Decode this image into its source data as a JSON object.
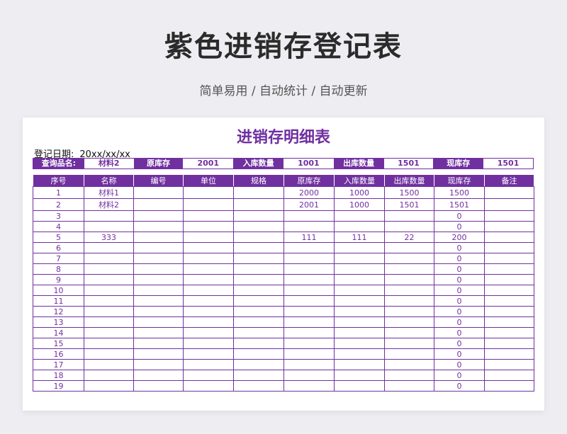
{
  "page": {
    "title": "紫色进销存登记表",
    "subtitle": "简单易用 / 自动统计 / 自动更新"
  },
  "sheet": {
    "title": "进销存明细表",
    "date_label": "登记日期:",
    "date_value": "20xx/xx/xx",
    "query": [
      {
        "label": "查询品名:",
        "value": "材料2"
      },
      {
        "label": "原库存",
        "value": "2001"
      },
      {
        "label": "入库数量",
        "value": "1001"
      },
      {
        "label": "出库数量",
        "value": "1501"
      },
      {
        "label": "现库存",
        "value": "1501"
      }
    ],
    "columns": [
      "序号",
      "名称",
      "编号",
      "单位",
      "规格",
      "原库存",
      "入库数量",
      "出库数量",
      "现库存",
      "备注"
    ],
    "rows": [
      [
        "1",
        "材料1",
        "",
        "",
        "",
        "2000",
        "1000",
        "1500",
        "1500",
        ""
      ],
      [
        "2",
        "材料2",
        "",
        "",
        "",
        "2001",
        "1000",
        "1501",
        "1501",
        ""
      ],
      [
        "3",
        "",
        "",
        "",
        "",
        "",
        "",
        "",
        "0",
        ""
      ],
      [
        "4",
        "",
        "",
        "",
        "",
        "",
        "",
        "",
        "0",
        ""
      ],
      [
        "5",
        "333",
        "",
        "",
        "",
        "111",
        "111",
        "22",
        "200",
        ""
      ],
      [
        "6",
        "",
        "",
        "",
        "",
        "",
        "",
        "",
        "0",
        ""
      ],
      [
        "7",
        "",
        "",
        "",
        "",
        "",
        "",
        "",
        "0",
        ""
      ],
      [
        "8",
        "",
        "",
        "",
        "",
        "",
        "",
        "",
        "0",
        ""
      ],
      [
        "9",
        "",
        "",
        "",
        "",
        "",
        "",
        "",
        "0",
        ""
      ],
      [
        "10",
        "",
        "",
        "",
        "",
        "",
        "",
        "",
        "0",
        ""
      ],
      [
        "11",
        "",
        "",
        "",
        "",
        "",
        "",
        "",
        "0",
        ""
      ],
      [
        "12",
        "",
        "",
        "",
        "",
        "",
        "",
        "",
        "0",
        ""
      ],
      [
        "13",
        "",
        "",
        "",
        "",
        "",
        "",
        "",
        "0",
        ""
      ],
      [
        "14",
        "",
        "",
        "",
        "",
        "",
        "",
        "",
        "0",
        ""
      ],
      [
        "15",
        "",
        "",
        "",
        "",
        "",
        "",
        "",
        "0",
        ""
      ],
      [
        "16",
        "",
        "",
        "",
        "",
        "",
        "",
        "",
        "0",
        ""
      ],
      [
        "17",
        "",
        "",
        "",
        "",
        "",
        "",
        "",
        "0",
        ""
      ],
      [
        "18",
        "",
        "",
        "",
        "",
        "",
        "",
        "",
        "0",
        ""
      ],
      [
        "19",
        "",
        "",
        "",
        "",
        "",
        "",
        "",
        "0",
        ""
      ]
    ]
  },
  "colors": {
    "accent": "#7030a0",
    "background": "#eeeef2"
  }
}
